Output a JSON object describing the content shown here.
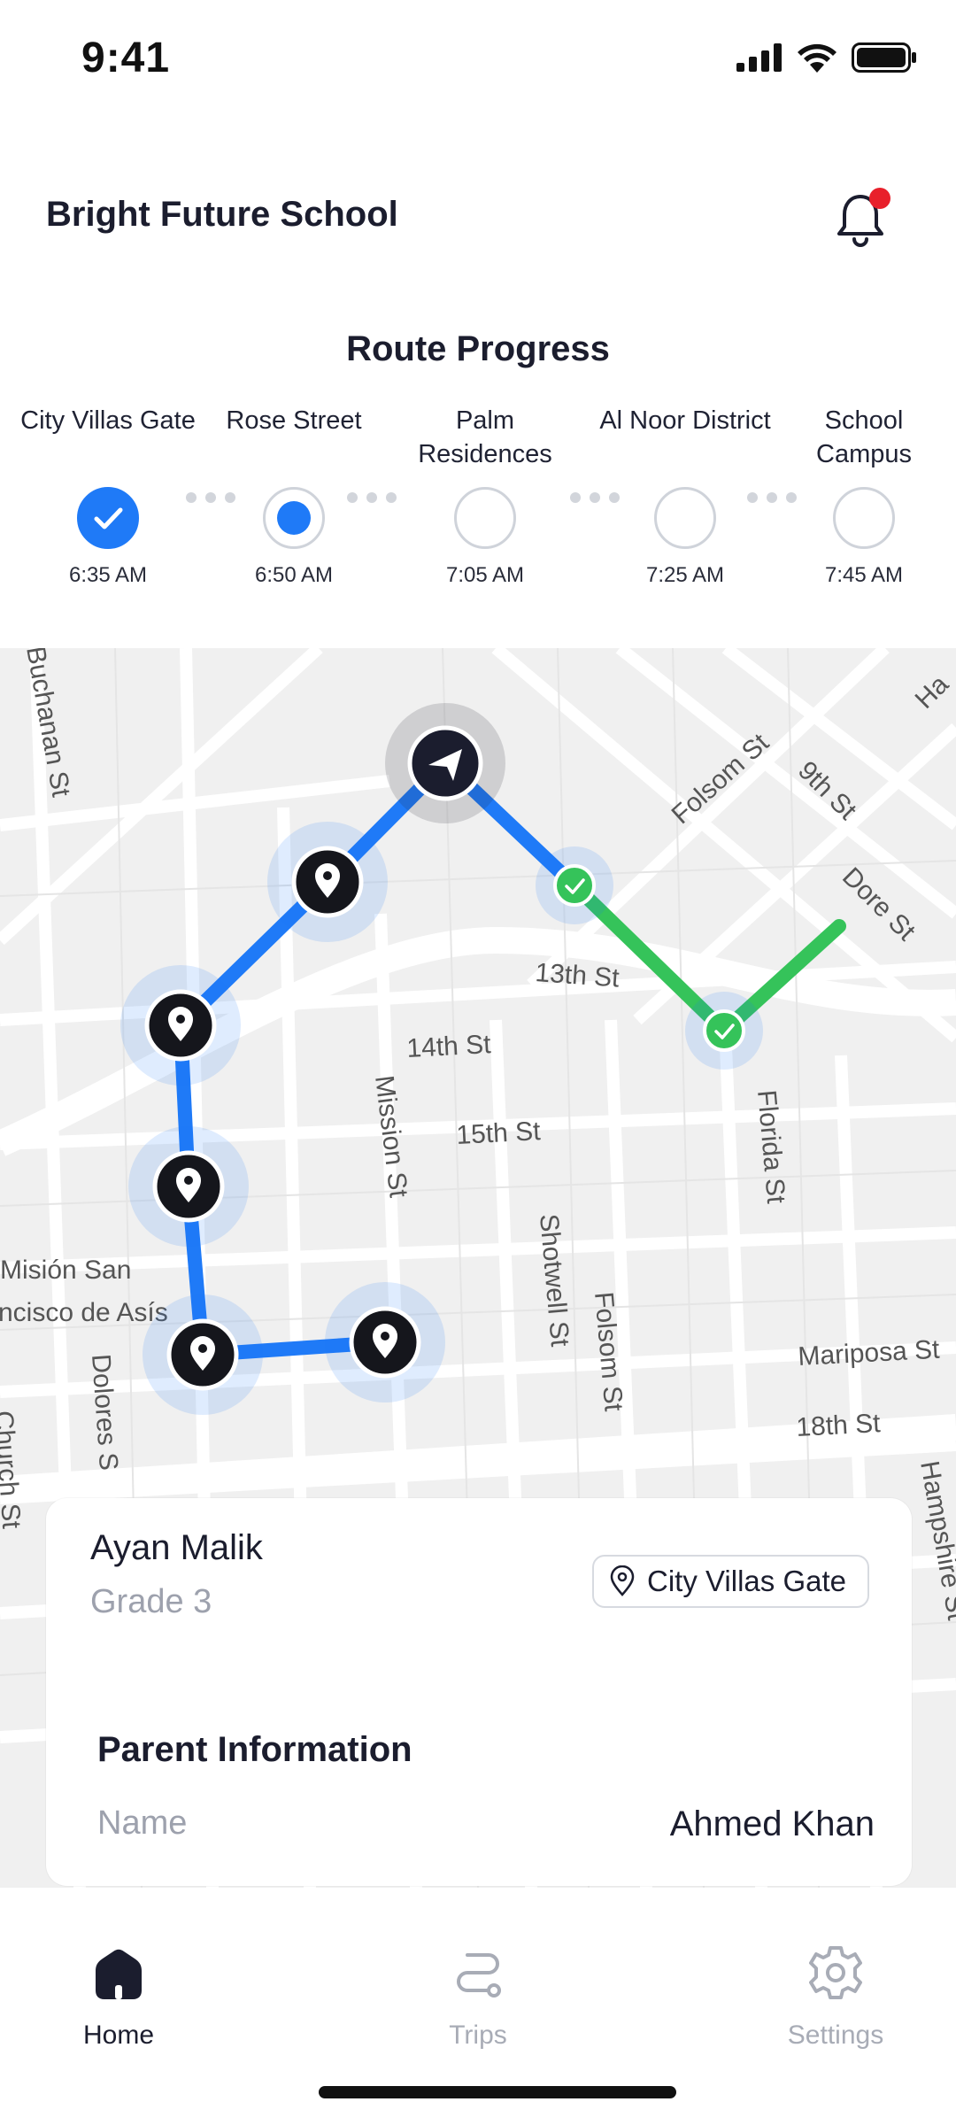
{
  "status_bar": {
    "time": "9:41"
  },
  "header": {
    "school_name": "Bright Future School"
  },
  "route_progress": {
    "title": "Route Progress",
    "stops": [
      {
        "name": "City Villas Gate",
        "time": "6:35 AM",
        "state": "done"
      },
      {
        "name": "Rose Street",
        "time": "6:50 AM",
        "state": "active"
      },
      {
        "name": "Palm Residences",
        "time": "7:05 AM",
        "state": "pending"
      },
      {
        "name": "Al Noor District",
        "time": "7:25 AM",
        "state": "pending"
      },
      {
        "name": "School Campus",
        "time": "7:45 AM",
        "state": "pending"
      }
    ]
  },
  "map": {
    "street_labels": [
      "Buchanan St",
      "Folsom St",
      "9th St",
      "Dore St",
      "13th St",
      "14th St",
      "15th St",
      "Mission St",
      "Shotwell St",
      "Folsom St",
      "Florida St",
      "Misión San",
      "ncisco de Asís",
      "Dolores S",
      "Church St",
      "Mariposa St",
      "18th St",
      "Hampshire St",
      "Ha"
    ],
    "colors": {
      "route_blue": "#1f7af7",
      "route_green": "#35c35a",
      "pin_dark": "#15161c"
    }
  },
  "student_card": {
    "name": "Ayan Malik",
    "grade": "Grade 3",
    "stop": "City Villas Gate",
    "parent_section_title": "Parent Information",
    "parent_name_label": "Name",
    "parent_name_value": "Ahmed Khan"
  },
  "tabs": [
    {
      "label": "Home",
      "icon": "home-icon",
      "active": true
    },
    {
      "label": "Trips",
      "icon": "route-icon",
      "active": false
    },
    {
      "label": "Settings",
      "icon": "gear-icon",
      "active": false
    }
  ]
}
